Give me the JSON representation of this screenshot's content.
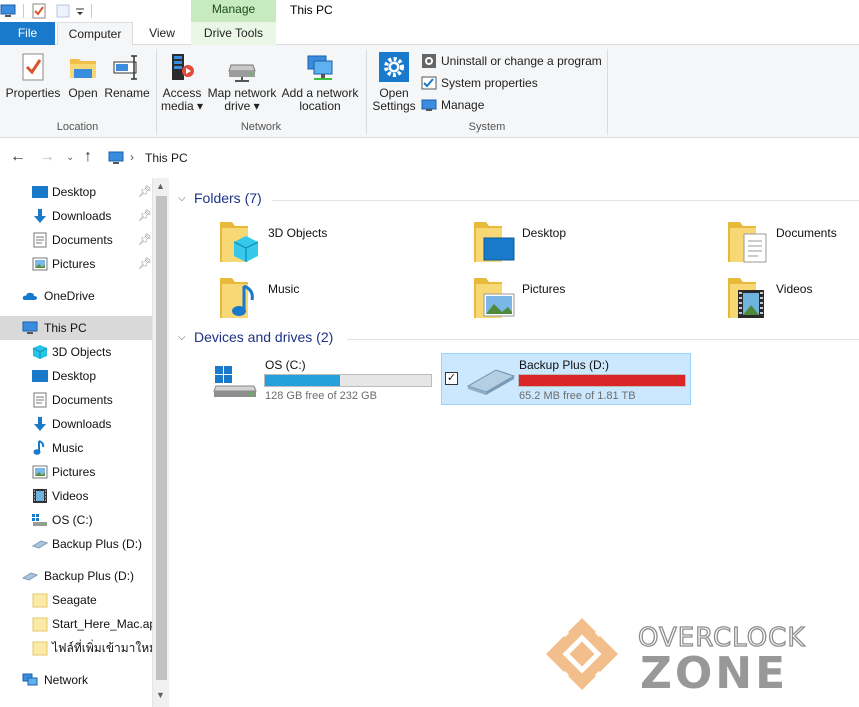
{
  "window": {
    "title": "This PC",
    "context_tab": "Manage"
  },
  "tabs": [
    {
      "label": "File"
    },
    {
      "label": "Computer"
    },
    {
      "label": "View"
    },
    {
      "label": "Drive Tools"
    }
  ],
  "ribbon": {
    "location": {
      "label": "Location",
      "buttons": [
        {
          "label": "Properties",
          "icon": "properties-icon"
        },
        {
          "label": "Open",
          "icon": "folder-open-icon"
        },
        {
          "label": "Rename",
          "icon": "rename-icon"
        }
      ]
    },
    "network": {
      "label": "Network",
      "buttons": [
        {
          "line1": "Access",
          "line2": "media ▾",
          "icon": "media-icon"
        },
        {
          "line1": "Map network",
          "line2": "drive ▾",
          "icon": "network-drive-icon"
        },
        {
          "line1": "Add a network",
          "line2": "location",
          "icon": "network-location-icon"
        }
      ]
    },
    "system": {
      "label": "System",
      "open_settings": {
        "line1": "Open",
        "line2": "Settings",
        "icon": "gear-icon"
      },
      "small_buttons": [
        {
          "label": "Uninstall or change a program",
          "icon": "uninstall-icon"
        },
        {
          "label": "System properties",
          "icon": "system-properties-icon"
        },
        {
          "label": "Manage",
          "icon": "manage-icon"
        }
      ]
    }
  },
  "address": {
    "path": "This PC",
    "separator": "›"
  },
  "sidebar": {
    "quick_access": [
      {
        "label": "Desktop"
      },
      {
        "label": "Downloads"
      },
      {
        "label": "Documents"
      },
      {
        "label": "Pictures"
      }
    ],
    "onedrive": "OneDrive",
    "this_pc": "This PC",
    "this_pc_items": [
      {
        "label": "3D Objects"
      },
      {
        "label": "Desktop"
      },
      {
        "label": "Documents"
      },
      {
        "label": "Downloads"
      },
      {
        "label": "Music"
      },
      {
        "label": "Pictures"
      },
      {
        "label": "Videos"
      },
      {
        "label": "OS (C:)"
      },
      {
        "label": "Backup Plus (D:)"
      }
    ],
    "backup_drive": "Backup Plus (D:)",
    "backup_items": [
      {
        "label": "Seagate"
      },
      {
        "label": "Start_Here_Mac.app"
      },
      {
        "label": "ไฟล์ที่เพิ่มเข้ามาใหม่ของ"
      }
    ],
    "network": "Network"
  },
  "content": {
    "folders_header": "Folders (7)",
    "folders": [
      {
        "label": "3D Objects"
      },
      {
        "label": "Desktop"
      },
      {
        "label": "Documents"
      },
      {
        "label": "Music"
      },
      {
        "label": "Pictures"
      },
      {
        "label": "Videos"
      }
    ],
    "drives_header": "Devices and drives (2)",
    "drives": [
      {
        "label": "OS (C:)",
        "free": "128 GB free of 232 GB",
        "used_fraction": 0.45,
        "bar_color": "#26a0da"
      },
      {
        "label": "Backup Plus (D:)",
        "free": "65.2 MB free of 1.81 TB",
        "used_fraction": 1.0,
        "bar_color": "#da2626",
        "selected": true
      }
    ]
  },
  "watermark": {
    "line1": "OVERCLOCK",
    "line2": "ZONE"
  },
  "colors": {
    "accent": "#1979ca",
    "context": "#c8eac0",
    "header_text": "#1e3287",
    "selection": "#cce8ff"
  }
}
